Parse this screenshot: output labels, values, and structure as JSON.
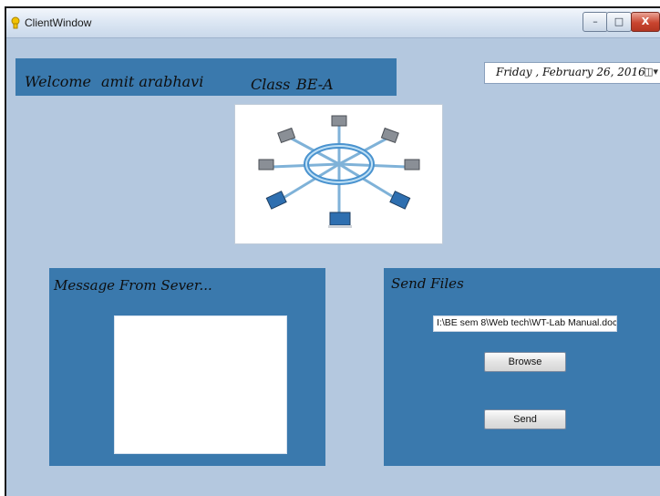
{
  "window": {
    "title": "ClientWindow",
    "minimize_glyph": "–",
    "maximize_glyph": "□",
    "close_glyph": "X"
  },
  "welcome": {
    "welcome_label": "Welcome",
    "user_name": "amit arabhavi",
    "class_label": "Class",
    "class_value": "BE-A"
  },
  "date": {
    "value": "Friday   , February 26, 2016",
    "dropdown_icon": "calendar-dropdown-icon"
  },
  "network_image": {
    "icon": "network-diagram-icon"
  },
  "message_panel": {
    "title": "Message From Sever..."
  },
  "send_panel": {
    "title": "Send Files",
    "file_path": "I:\\BE sem 8\\Web tech\\WT-Lab Manual.doc",
    "browse_label": "Browse",
    "send_label": "Send"
  },
  "colors": {
    "panel": "#3a79ad",
    "background": "#b4c8df"
  }
}
